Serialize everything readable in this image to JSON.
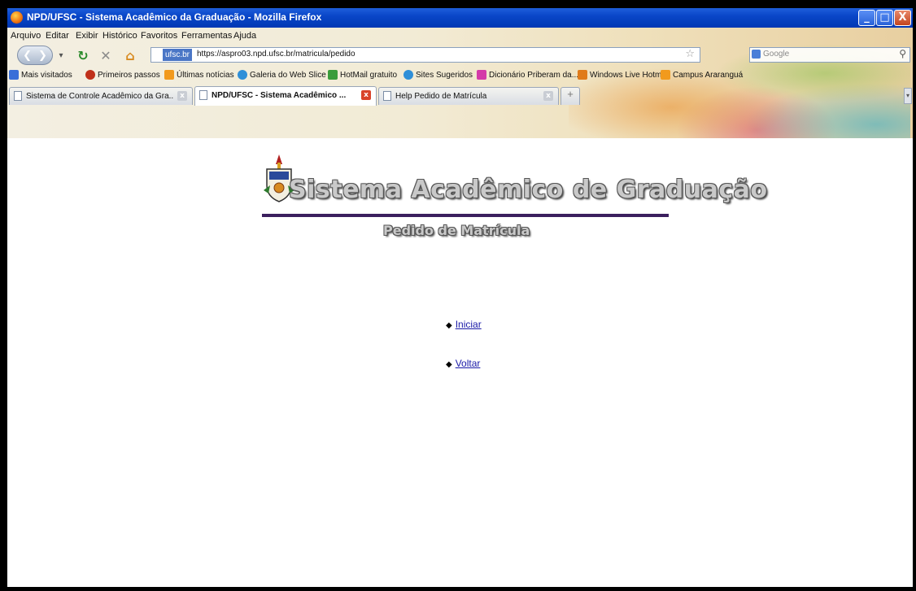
{
  "window": {
    "title": "NPD/UFSC - Sistema Acadêmico da Graduação - Mozilla Firefox",
    "controls": [
      "_",
      "□",
      "X"
    ]
  },
  "menu": [
    "Arquivo",
    "Editar",
    "Exibir",
    "Histórico",
    "Favoritos",
    "Ferramentas",
    "Ajuda"
  ],
  "nav": {
    "identity": "ufsc.br",
    "url": "https://aspro03.npd.ufsc.br/matricula/pedido",
    "search_placeholder": "Google"
  },
  "bookmarks": [
    {
      "label": "Mais visitados",
      "icon": "star-icon",
      "color": "#3a6fd8"
    },
    {
      "label": "Primeiros passos",
      "icon": "firefox-icon",
      "color": "#c0301a"
    },
    {
      "label": "Últimas notícias",
      "icon": "rss-icon",
      "color": "#f29a1d"
    },
    {
      "label": "Galeria do Web Slice",
      "icon": "ie-icon",
      "color": "#2f8fd8"
    },
    {
      "label": "HotMail gratuito",
      "icon": "msn-icon",
      "color": "#3a9c3a"
    },
    {
      "label": "Sites Sugeridos",
      "icon": "ie-icon",
      "color": "#2f8fd8"
    },
    {
      "label": "Dicionário Priberam da...",
      "icon": "flip-icon",
      "color": "#d43aa8"
    },
    {
      "label": "Windows Live Hotmail",
      "icon": "mail-icon",
      "color": "#e07b1a"
    },
    {
      "label": "Campus Araranguá",
      "icon": "rss-icon",
      "color": "#f29a1d"
    }
  ],
  "tabs": [
    {
      "label": "Sistema de Controle Acadêmico da Gra...",
      "active": false
    },
    {
      "label": "NPD/UFSC - Sistema Acadêmico ...",
      "active": true
    },
    {
      "label": "Help Pedido de Matrícula",
      "active": false
    }
  ],
  "page": {
    "heading": "Sistema Acadêmico de Graduação",
    "subheading": "Pedido de Matrícula",
    "links": [
      "Iniciar",
      "Voltar"
    ]
  }
}
